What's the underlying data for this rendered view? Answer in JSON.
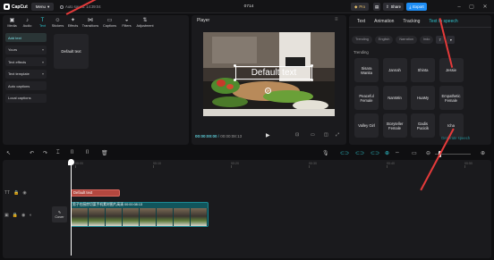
{
  "titlebar": {
    "app_name": "CapCut",
    "menu_label": "Menu",
    "autosave": "Auto saved: 14:39:04",
    "project_title": "0714",
    "pro_label": "Pro",
    "share_label": "Share",
    "export_label": "Export"
  },
  "toolbar": {
    "items": [
      {
        "label": "Media",
        "icon": "media-icon"
      },
      {
        "label": "Audio",
        "icon": "audio-icon"
      },
      {
        "label": "Text",
        "icon": "text-icon"
      },
      {
        "label": "Stickers",
        "icon": "stickers-icon"
      },
      {
        "label": "Effects",
        "icon": "effects-icon"
      },
      {
        "label": "Transitions",
        "icon": "transitions-icon"
      },
      {
        "label": "Captions",
        "icon": "captions-icon"
      },
      {
        "label": "Filters",
        "icon": "filters-icon"
      },
      {
        "label": "Adjustment",
        "icon": "adjustment-icon"
      }
    ],
    "active": "Text"
  },
  "text_sidebar": {
    "items": [
      "Add text",
      "Yours",
      "Text effects",
      "Text template",
      "Auto captions",
      "Local captions"
    ]
  },
  "default_card": {
    "label": "Default text"
  },
  "player": {
    "title": "Player",
    "overlay_text": "Default text",
    "current_time": "00:00:00:00",
    "total_time": "00:00:08:13"
  },
  "right_panel": {
    "tabs": [
      "Text",
      "Animation",
      "Tracking",
      "Text to speech"
    ],
    "active_tab": "Text to speech",
    "filter_chips": [
      "Trending",
      "English",
      "Narration",
      "Indo"
    ],
    "section_title": "Trending",
    "voices": [
      "Sisara Wanita",
      "Jannah",
      "Shinta",
      "Jessie",
      "Peaceful Female",
      "NamMin",
      "HuaMy",
      "Empathetic Female",
      "Valley Girl",
      "Storyteller Female",
      "Gadis Pucicik",
      "Icha"
    ],
    "footer_action": "Generate speech"
  },
  "timeline": {
    "ruler_ticks": [
      "00:00",
      "00:10",
      "00:20",
      "00:30",
      "00:40",
      "00:50",
      "01:00"
    ],
    "text_clip_label": "Default text",
    "video_clip_label": "男子在厨房切菜手机素材图片高清",
    "video_clip_duration": "00:00:08:13",
    "cover_label": "Cover"
  },
  "colors": {
    "accent": "#2ec5cf",
    "export": "#1d8df5",
    "text_clip": "#b3473f",
    "video_clip": "#11555c",
    "annotation_arrow": "#e53a3a"
  }
}
